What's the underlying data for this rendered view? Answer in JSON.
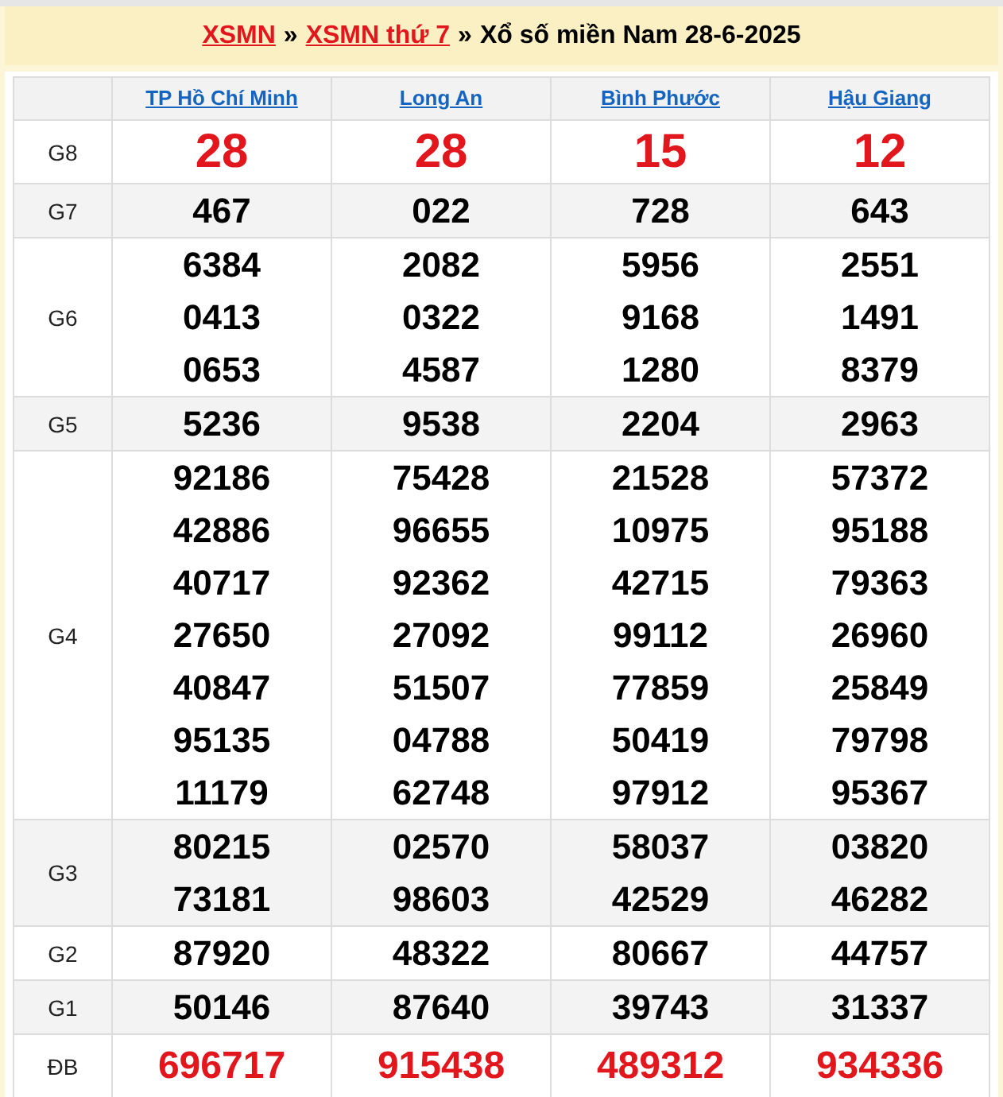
{
  "breadcrumb": [
    {
      "kind": "link",
      "text": "XSMN"
    },
    {
      "kind": "separator",
      "text": "»"
    },
    {
      "kind": "link",
      "text": "XSMN thứ 7"
    },
    {
      "kind": "separator",
      "text": "»"
    },
    {
      "kind": "title",
      "text": "Xổ số miền Nam 28-6-2025"
    }
  ],
  "table": {
    "columns": [
      "TP Hồ Chí Minh",
      "Long An",
      "Bình Phước",
      "Hậu Giang"
    ],
    "rows": [
      {
        "prize": "G8",
        "kind": "special",
        "shaded": false,
        "cells": [
          [
            "28"
          ],
          [
            "28"
          ],
          [
            "15"
          ],
          [
            "12"
          ]
        ]
      },
      {
        "prize": "G7",
        "kind": "normal",
        "shaded": true,
        "cells": [
          [
            "467"
          ],
          [
            "022"
          ],
          [
            "728"
          ],
          [
            "643"
          ]
        ]
      },
      {
        "prize": "G6",
        "kind": "normal",
        "shaded": false,
        "cells": [
          [
            "6384",
            "0413",
            "0653"
          ],
          [
            "2082",
            "0322",
            "4587"
          ],
          [
            "5956",
            "9168",
            "1280"
          ],
          [
            "2551",
            "1491",
            "8379"
          ]
        ]
      },
      {
        "prize": "G5",
        "kind": "normal",
        "shaded": true,
        "cells": [
          [
            "5236"
          ],
          [
            "9538"
          ],
          [
            "2204"
          ],
          [
            "2963"
          ]
        ]
      },
      {
        "prize": "G4",
        "kind": "normal",
        "shaded": false,
        "cells": [
          [
            "92186",
            "42886",
            "40717",
            "27650",
            "40847",
            "95135",
            "11179"
          ],
          [
            "75428",
            "96655",
            "92362",
            "27092",
            "51507",
            "04788",
            "62748"
          ],
          [
            "21528",
            "10975",
            "42715",
            "99112",
            "77859",
            "50419",
            "97912"
          ],
          [
            "57372",
            "95188",
            "79363",
            "26960",
            "25849",
            "79798",
            "95367"
          ]
        ]
      },
      {
        "prize": "G3",
        "kind": "normal",
        "shaded": true,
        "cells": [
          [
            "80215",
            "73181"
          ],
          [
            "02570",
            "98603"
          ],
          [
            "58037",
            "42529"
          ],
          [
            "03820",
            "46282"
          ]
        ]
      },
      {
        "prize": "G2",
        "kind": "normal",
        "shaded": false,
        "cells": [
          [
            "87920"
          ],
          [
            "48322"
          ],
          [
            "80667"
          ],
          [
            "44757"
          ]
        ]
      },
      {
        "prize": "G1",
        "kind": "normal",
        "shaded": true,
        "cells": [
          [
            "50146"
          ],
          [
            "87640"
          ],
          [
            "39743"
          ],
          [
            "31337"
          ]
        ]
      },
      {
        "prize": "ĐB",
        "kind": "jackpot",
        "shaded": false,
        "cells": [
          [
            "696717"
          ],
          [
            "915438"
          ],
          [
            "489312"
          ],
          [
            "934336"
          ]
        ]
      }
    ]
  }
}
